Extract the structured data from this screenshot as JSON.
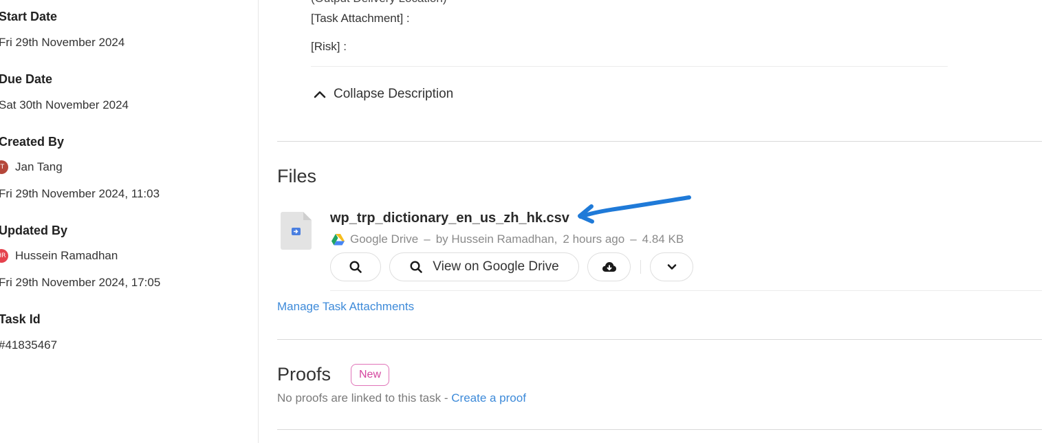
{
  "sidebar": {
    "start_date": {
      "label": "Start Date",
      "value": "Fri 29th November 2024"
    },
    "due_date": {
      "label": "Due Date",
      "value": "Sat 30th November 2024"
    },
    "created_by": {
      "label": "Created By",
      "initials": "JT",
      "name": "Jan Tang",
      "date": "Fri 29th November 2024, 11:03",
      "avatar_color": "#b5473a"
    },
    "updated_by": {
      "label": "Updated By",
      "initials": "HR",
      "name": "Hussein Ramadhan",
      "date": "Fri 29th November 2024, 17:05",
      "avatar_color": "#e5424d"
    },
    "task_id": {
      "label": "Task Id",
      "value": "#41835467"
    }
  },
  "description": {
    "cut_line": "(Output Delivery Location)",
    "task_attachment": "[Task Attachment] :",
    "risk": "[Risk] :",
    "collapse_label": "Collapse Description"
  },
  "files": {
    "title": "Files",
    "file": {
      "name": "wp_trp_dictionary_en_us_zh_hk.csv",
      "source": "Google Drive",
      "sep1": "–",
      "by": "by Hussein Ramadhan,",
      "time": "2 hours ago",
      "sep2": "–",
      "size": "4.84 KB",
      "view_label": "View on Google Drive"
    },
    "manage_link": "Manage Task Attachments"
  },
  "proofs": {
    "title": "Proofs",
    "badge": "New",
    "empty_text": "No proofs are linked to this task -",
    "create_link": "Create a proof"
  },
  "colors": {
    "link": "#3d8ad9",
    "badge": "#d4459f",
    "annotation": "#1f7ad8"
  }
}
